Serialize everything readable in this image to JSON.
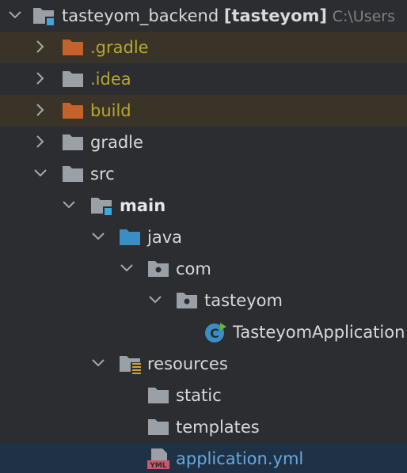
{
  "tree": {
    "root": {
      "name": "tasteyom_backend",
      "module": "[tasteyom]",
      "path": "C:\\Users"
    },
    "items": [
      {
        "label": ".gradle"
      },
      {
        "label": ".idea"
      },
      {
        "label": "build"
      },
      {
        "label": "gradle"
      },
      {
        "label": "src"
      },
      {
        "label": "main"
      },
      {
        "label": "java"
      },
      {
        "label": "com"
      },
      {
        "label": "tasteyom"
      },
      {
        "label": "TasteyomApplication"
      },
      {
        "label": "resources"
      },
      {
        "label": "static"
      },
      {
        "label": "templates"
      },
      {
        "label": "application.yml"
      }
    ]
  },
  "colors": {
    "background": "#2b2d30",
    "excluded_row": "#3a3428",
    "selected_row": "#1f3245",
    "excluded_text": "#b5a82e",
    "folder_grey": "#9aa0a6",
    "folder_orange": "#c4622c",
    "source_blue": "#3a8ec4",
    "yml_text": "#6aa7df"
  },
  "icons": [
    "chevron-down-icon",
    "chevron-right-icon",
    "folder-icon",
    "module-folder-icon",
    "package-icon",
    "source-folder-icon",
    "resources-folder-icon",
    "spring-class-icon",
    "yml-file-icon"
  ]
}
